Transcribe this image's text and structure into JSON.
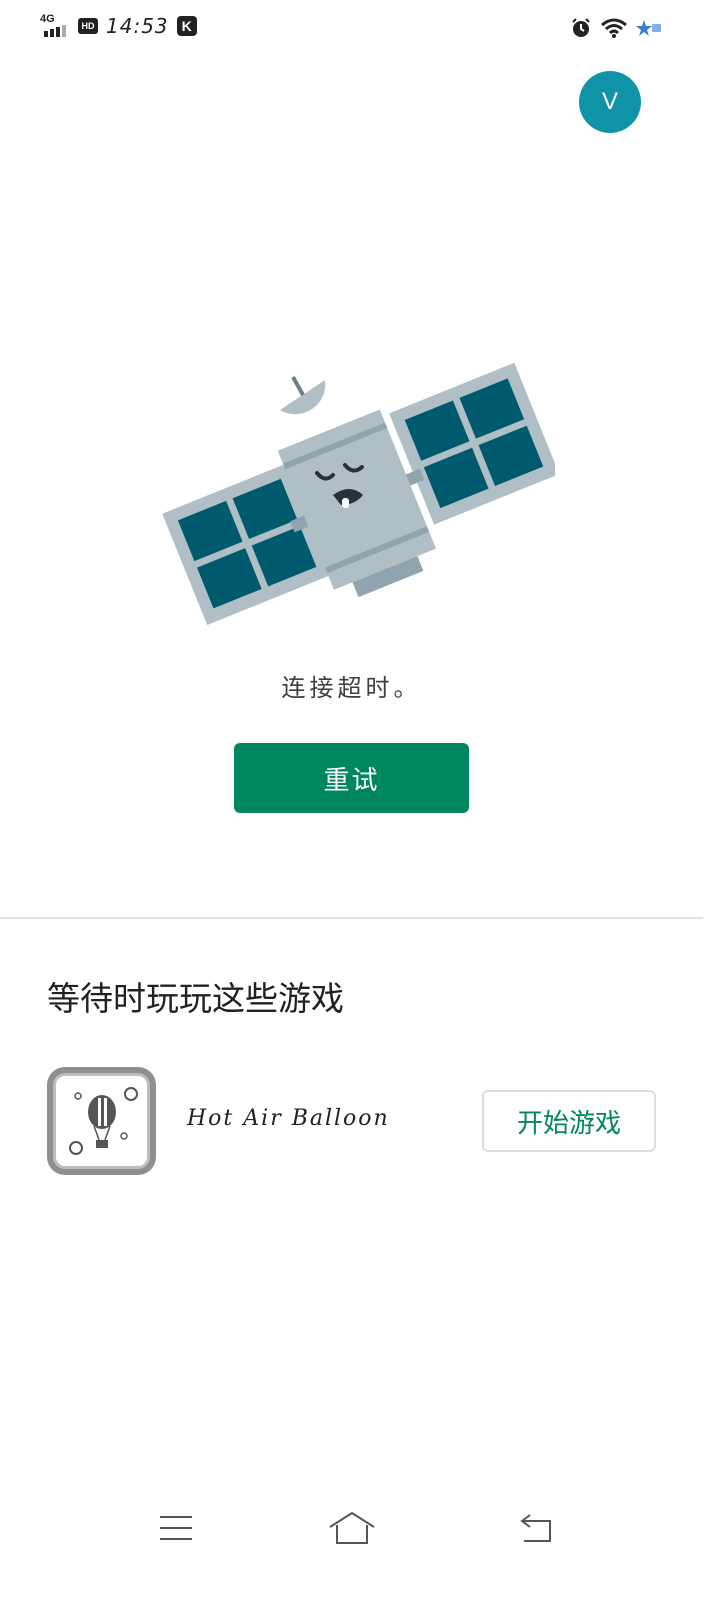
{
  "status_bar": {
    "network": "4G",
    "hd_label": "HD",
    "time": "14:53",
    "app_badge": "K"
  },
  "header": {
    "avatar_letter": "V"
  },
  "error": {
    "message": "连接超时。",
    "retry_label": "重试"
  },
  "games": {
    "title": "等待时玩玩这些游戏",
    "items": [
      {
        "name": "Hot Air Balloon",
        "play_label": "开始游戏",
        "icon": "hot-air-balloon-icon"
      }
    ]
  },
  "colors": {
    "accent": "#01875f",
    "avatar": "#0f93a6",
    "satellite_panel": "#005a6e",
    "satellite_body": "#b0bec5"
  }
}
